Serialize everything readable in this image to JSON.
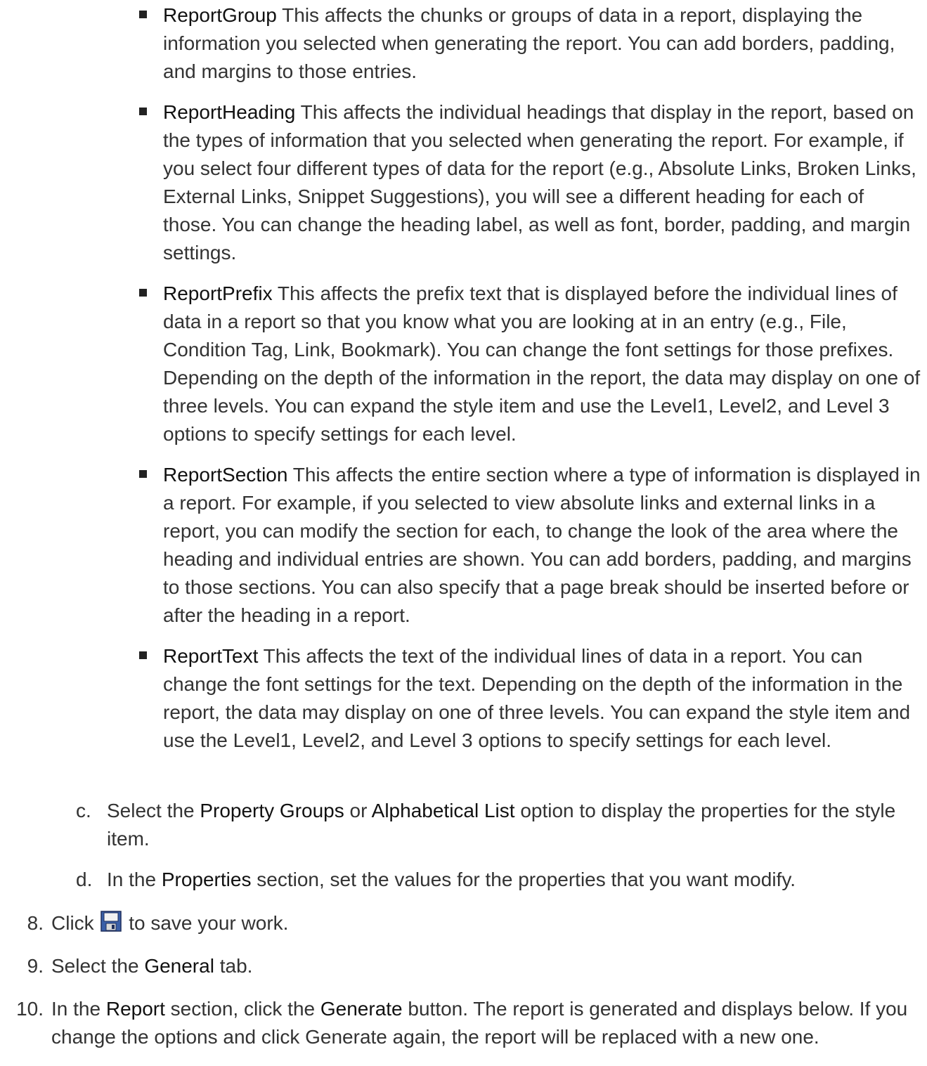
{
  "bullets": [
    {
      "term": "ReportGroup",
      "text": " This affects the chunks or groups of data in a report, displaying the information you selected when generating the report. You can add borders, padding, and margins to those entries."
    },
    {
      "term": "ReportHeading",
      "text": " This affects the individual headings that display in the report, based on the types of information that you selected when generating the report. For example, if you select four different types of data for the report (e.g., Absolute Links, Broken Links, External Links, Snippet Suggestions), you will see a different heading for each of those. You can change the heading label, as well as font, border, padding, and margin settings."
    },
    {
      "term": "ReportPrefix",
      "text": " This affects the prefix text that is displayed before the individual lines of data in a report so that you know what you are looking at in an entry (e.g., File, Condition Tag, Link, Bookmark). You can change the font settings for those prefixes. Depending on the depth of the information in the report, the data may display on one of three levels. You can expand the style item and use the Level1, Level2, and Level 3 options to specify settings for each level."
    },
    {
      "term": "ReportSection",
      "text": " This affects the entire section where a type of information is displayed in a report. For example, if you selected to view absolute links and external links in a report, you can modify the section for each, to change the look of the area where the heading and individual entries are shown. You can add borders, padding, and margins to those sections. You can also specify that a page break should be inserted before or after the heading in a report."
    },
    {
      "term": "ReportText",
      "text": " This affects the text of the individual lines of data in a report. You can change the font settings for the text. Depending on the depth of the information in the report, the data may display on one of three levels. You can expand the style item and use the Level1, Level2, and Level 3 options to specify settings for each level."
    }
  ],
  "substeps": [
    {
      "marker": "c.",
      "t1": "Select the ",
      "b1": "Property Groups",
      "t2": " or ",
      "b2": "Alphabetical List",
      "t3": " option to display the properties for the style item."
    },
    {
      "marker": "d.",
      "t1": "In the ",
      "b1": "Properties",
      "t2": " section, set the values for the properties that you want modify."
    }
  ],
  "steps": [
    {
      "num": "8.",
      "pre": "Click ",
      "icon": "save-icon",
      "post": " to save your work."
    },
    {
      "num": "9.",
      "t1": "Select the ",
      "b1": "General",
      "t2": " tab."
    },
    {
      "num": "10.",
      "t1": "In the ",
      "b1": "Report",
      "t2": " section, click the ",
      "b2": "Generate",
      "t3": " button. The report is generated and displays below. If you change the options and click Generate again, the report will be replaced with a new one."
    }
  ]
}
